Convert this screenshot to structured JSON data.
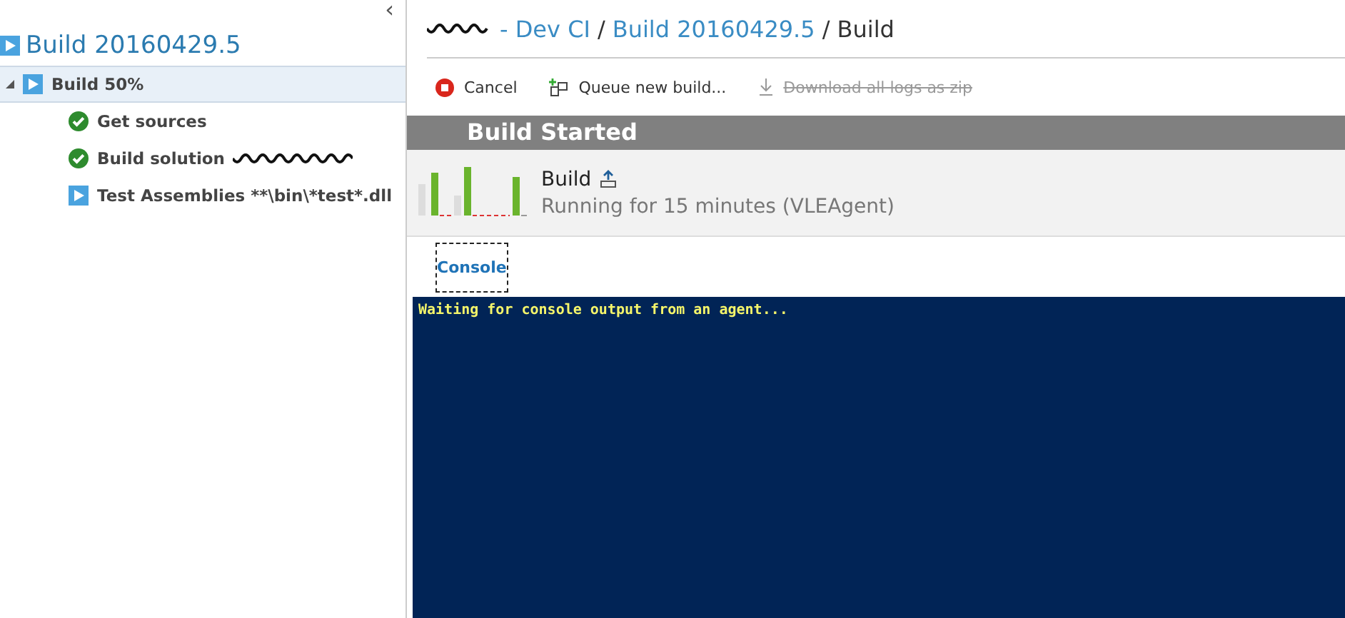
{
  "sidebar": {
    "collapse_glyph": "‹",
    "title": "Build 20160429.5",
    "tree": [
      {
        "label": "Build 50%",
        "kind": "running",
        "expanded": true,
        "selected": true,
        "children": [
          {
            "label": "Get sources",
            "kind": "succeeded",
            "redacted": false
          },
          {
            "label": "Build solution",
            "kind": "succeeded",
            "redacted": true
          },
          {
            "label": "Test Assemblies **\\bin\\*test*.dll",
            "kind": "running",
            "redacted": false
          }
        ]
      }
    ]
  },
  "breadcrumb": [
    {
      "text": "- Dev CI",
      "link": true
    },
    {
      "text": "/",
      "link": false
    },
    {
      "text": "Build 20160429.5",
      "link": true
    },
    {
      "text": "/ Build",
      "link": false
    }
  ],
  "toolbar": [
    {
      "kind": "cancel",
      "label": "Cancel",
      "disabled": false
    },
    {
      "kind": "queue",
      "label": "Queue new build...",
      "disabled": false
    },
    {
      "kind": "download",
      "label": "Download all logs as zip",
      "disabled": true
    }
  ],
  "status_banner": "Build Started",
  "build": {
    "name": "Build",
    "status": "Running for 15 minutes (VLEAgent)"
  },
  "tabs": [
    {
      "label": "Console",
      "selected": true
    }
  ],
  "console": {
    "lines": [
      "Waiting for console output from an agent..."
    ]
  }
}
